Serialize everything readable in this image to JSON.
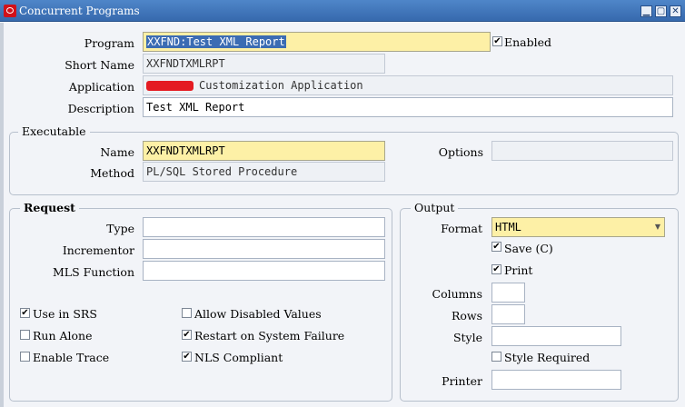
{
  "window": {
    "title": "Concurrent Programs",
    "buttons": {
      "minimize": "▁",
      "maximize": "▢",
      "close": "✕"
    }
  },
  "header_fields": {
    "program_label": "Program",
    "program_value": "XXFND:Test XML Report",
    "enabled_label": "Enabled",
    "enabled_checked": "✔",
    "short_name_label": "Short Name",
    "short_name_value": "XXFNDTXMLRPT",
    "application_label": "Application",
    "application_value": "Customization Application",
    "description_label": "Description",
    "description_value": "Test XML Report"
  },
  "executable": {
    "legend": "Executable",
    "name_label": "Name",
    "name_value": "XXFNDTXMLRPT",
    "options_label": "Options",
    "options_value": "",
    "method_label": "Method",
    "method_value": "PL/SQL Stored Procedure"
  },
  "request": {
    "legend": "Request",
    "type_label": "Type",
    "type_value": "",
    "incrementor_label": "Incrementor",
    "incrementor_value": "",
    "mls_label": "MLS Function",
    "mls_value": "",
    "checkboxes": [
      {
        "label": "Use in SRS",
        "mark": "✔"
      },
      {
        "label": "Allow Disabled Values",
        "mark": ""
      },
      {
        "label": "Run Alone",
        "mark": ""
      },
      {
        "label": "Restart on System Failure",
        "mark": "✔"
      },
      {
        "label": "Enable Trace",
        "mark": ""
      },
      {
        "label": "NLS Compliant",
        "mark": "✔"
      }
    ]
  },
  "output": {
    "legend": "Output",
    "format_label": "Format",
    "format_value": "HTML",
    "dropdown_arrow": "▼",
    "save_label": "Save (C)",
    "save_mark": "✔",
    "print_label": "Print",
    "print_mark": "✔",
    "columns_label": "Columns",
    "columns_value": "",
    "rows_label": "Rows",
    "rows_value": "",
    "style_label": "Style",
    "style_value": "",
    "style_required_label": "Style Required",
    "style_required_mark": "",
    "printer_label": "Printer",
    "printer_value": ""
  },
  "colors": {
    "titlebar": "#3f76bb",
    "required_field": "#fdf0a6",
    "selection": "#3b6cb3",
    "background": "#f2f4f8"
  }
}
